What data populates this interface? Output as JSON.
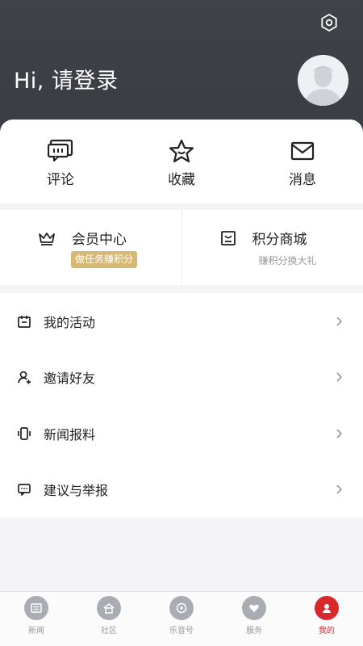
{
  "header": {
    "greeting": "Hi, 请登录",
    "settings_icon": "settings-hexagon-icon",
    "avatar_icon": "user-avatar-placeholder-icon"
  },
  "quick_actions": [
    {
      "label": "评论",
      "icon": "comment-icon"
    },
    {
      "label": "收藏",
      "icon": "star-icon"
    },
    {
      "label": "消息",
      "icon": "mail-icon"
    }
  ],
  "member": {
    "title": "会员中心",
    "badge": "做任务赚积分",
    "icon": "crown-icon"
  },
  "points": {
    "title": "积分商城",
    "subtitle": "赚积分换大礼",
    "icon": "store-icon"
  },
  "menu": [
    {
      "label": "我的活动",
      "icon": "calendar-icon"
    },
    {
      "label": "邀请好友",
      "icon": "add-user-icon"
    },
    {
      "label": "新闻报料",
      "icon": "phone-vibrate-icon"
    },
    {
      "label": "建议与举报",
      "icon": "chat-bubble-icon"
    }
  ],
  "bottom_nav": [
    {
      "label": "新闻",
      "icon": "news-icon",
      "active": false
    },
    {
      "label": "社区",
      "icon": "home-icon",
      "active": false
    },
    {
      "label": "乐音号",
      "icon": "music-disc-icon",
      "active": false
    },
    {
      "label": "服务",
      "icon": "heart-hands-icon",
      "active": false
    },
    {
      "label": "我的",
      "icon": "user-icon",
      "active": true
    }
  ],
  "colors": {
    "header_bg": "#3f4248",
    "badge_gold": "#d7b874",
    "active_red": "#d8282b",
    "inactive_gray": "#a9acb2"
  }
}
